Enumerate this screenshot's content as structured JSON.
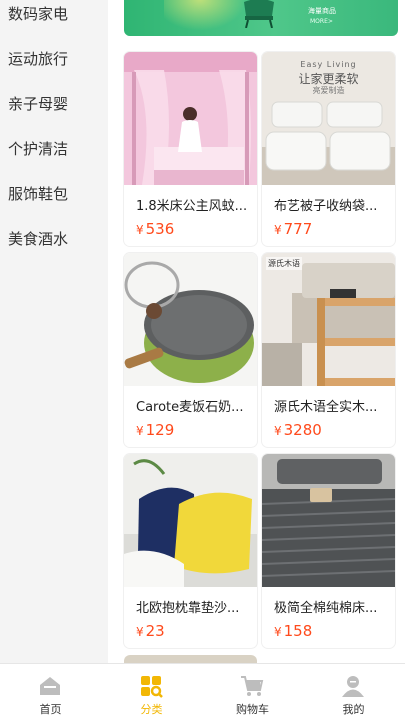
{
  "sidebar": {
    "items": [
      {
        "label": "数码家电"
      },
      {
        "label": "运动旅行"
      },
      {
        "label": "亲子母婴"
      },
      {
        "label": "个护清洁"
      },
      {
        "label": "服饰鞋包"
      },
      {
        "label": "美食酒水"
      }
    ]
  },
  "banner": {
    "line1": "海量商品",
    "line2": "MORE>"
  },
  "products": [
    {
      "name": "1.8米床公主风蚊...",
      "currency": "¥",
      "price": "536",
      "image": "pink-canopy-bed"
    },
    {
      "name": "布艺被子收纳袋...",
      "currency": "¥",
      "price": "777",
      "image": "storage-bags",
      "image_text_top": "Easy Living",
      "image_text_main": "让家更柔软",
      "image_text_sub": "亮爱制造"
    },
    {
      "name": "Carote麦饭石奶...",
      "currency": "¥",
      "price": "129",
      "image": "green-saucepan"
    },
    {
      "name": "源氏木语全实木...",
      "currency": "¥",
      "price": "3280",
      "image": "wooden-shelf",
      "image_logo": "源氏木语"
    },
    {
      "name": "北欧抱枕靠垫沙...",
      "currency": "¥",
      "price": "23",
      "image": "cushions"
    },
    {
      "name": "极简全棉纯棉床...",
      "currency": "¥",
      "price": "158",
      "image": "grey-bedding"
    }
  ],
  "tabbar": {
    "tabs": [
      {
        "label": "首页",
        "icon": "home-icon"
      },
      {
        "label": "分类",
        "icon": "category-icon",
        "active": true
      },
      {
        "label": "购物车",
        "icon": "cart-icon"
      },
      {
        "label": "我的",
        "icon": "profile-icon"
      }
    ]
  },
  "colors": {
    "accent": "#f2b705",
    "price": "#ff4a1c",
    "banner": "#2fb573"
  }
}
